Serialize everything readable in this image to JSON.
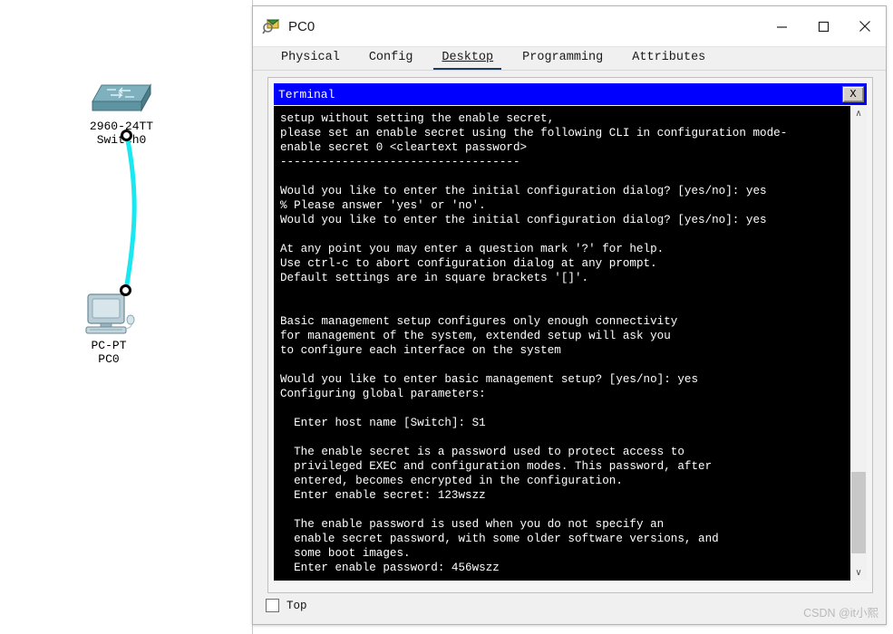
{
  "workspace": {
    "switch": {
      "icon": "switch-device-icon",
      "model_label": "2960-24TT",
      "name_label": "Switch0"
    },
    "pc": {
      "icon": "pc-device-icon",
      "model_label": "PC-PT",
      "name_label": "PC0"
    },
    "link": {
      "color": "#19e8f0",
      "type": "copper-straight-through"
    }
  },
  "window": {
    "icon": "packet-tracer-device-icon",
    "title": "PC0",
    "controls": {
      "minimize": "─",
      "maximize": "□",
      "close": "✕"
    }
  },
  "tabs": [
    {
      "label": "Physical",
      "active": false
    },
    {
      "label": "Config",
      "active": false
    },
    {
      "label": "Desktop",
      "active": true
    },
    {
      "label": "Programming",
      "active": false
    },
    {
      "label": "Attributes",
      "active": false
    }
  ],
  "terminal": {
    "title": "Terminal",
    "close_label": "X",
    "title_bar_color": "#0000ff",
    "background_color": "#000000",
    "text_color": "#ffffff",
    "lines": [
      "setup without setting the enable secret,",
      "please set an enable secret using the following CLI in configuration mode-",
      "enable secret 0 <cleartext password>",
      "-----------------------------------",
      "",
      "Would you like to enter the initial configuration dialog? [yes/no]: yes",
      "% Please answer 'yes' or 'no'.",
      "Would you like to enter the initial configuration dialog? [yes/no]: yes",
      "",
      "At any point you may enter a question mark '?' for help.",
      "Use ctrl-c to abort configuration dialog at any prompt.",
      "Default settings are in square brackets '[]'.",
      "",
      "",
      "Basic management setup configures only enough connectivity",
      "for management of the system, extended setup will ask you",
      "to configure each interface on the system",
      "",
      "Would you like to enter basic management setup? [yes/no]: yes",
      "Configuring global parameters:",
      "",
      "  Enter host name [Switch]: S1",
      "",
      "  The enable secret is a password used to protect access to",
      "  privileged EXEC and configuration modes. This password, after",
      "  entered, becomes encrypted in the configuration.",
      "  Enter enable secret: 123wszz",
      "",
      "  The enable password is used when you do not specify an",
      "  enable secret password, with some older software versions, and",
      "  some boot images.",
      "  Enter enable password: 456wszz"
    ],
    "scrollbar": {
      "up_arrow": "∧",
      "down_arrow": "∨"
    }
  },
  "footer": {
    "top_checkbox_label": "Top",
    "top_checkbox_checked": false,
    "watermark": "CSDN @it小熙"
  }
}
